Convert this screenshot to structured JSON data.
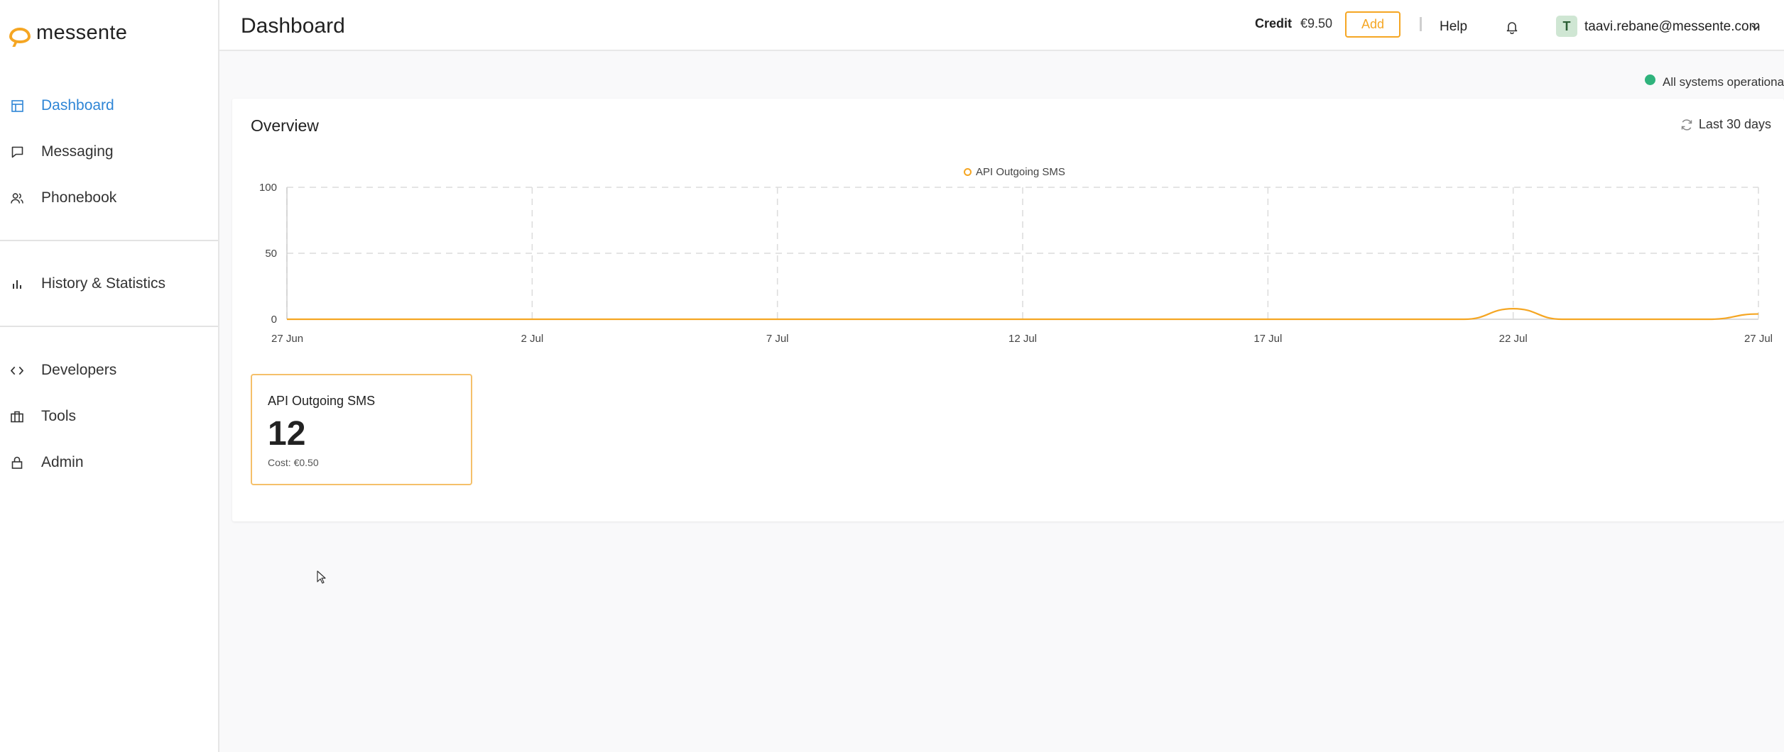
{
  "app": {
    "logo_text": "messente"
  },
  "sidebar": {
    "items": [
      {
        "label": "Dashboard",
        "icon": "dashboard-icon",
        "active": true
      },
      {
        "label": "Messaging",
        "icon": "message-icon"
      },
      {
        "label": "Phonebook",
        "icon": "people-icon"
      },
      {
        "label": "History & Statistics",
        "icon": "bar-chart-icon"
      },
      {
        "label": "Developers",
        "icon": "code-icon"
      },
      {
        "label": "Tools",
        "icon": "briefcase-icon"
      },
      {
        "label": "Admin",
        "icon": "lock-icon"
      }
    ]
  },
  "header": {
    "title": "Dashboard",
    "credit_label": "Credit",
    "credit_value": "€9.50",
    "add_label": "Add",
    "help_label": "Help",
    "avatar_initial": "T",
    "user_email": "taavi.rebane@messente.com"
  },
  "status": {
    "text": "All systems operational",
    "color": "#2fb37c"
  },
  "overview": {
    "title": "Overview",
    "range_label": "Last 30 days"
  },
  "chart_data": {
    "type": "line",
    "series": [
      {
        "name": "API Outgoing SMS",
        "color": "#f5a623",
        "points": [
          {
            "day": 0,
            "value": 0
          },
          {
            "day": 24,
            "value": 0
          },
          {
            "day": 25,
            "value": 8
          },
          {
            "day": 26,
            "value": 0
          },
          {
            "day": 29,
            "value": 0
          },
          {
            "day": 30,
            "value": 4
          }
        ]
      }
    ],
    "x_ticks": [
      "27 Jun",
      "2 Jul",
      "7 Jul",
      "12 Jul",
      "17 Jul",
      "22 Jul",
      "27 Jul"
    ],
    "x_range": [
      0,
      30
    ],
    "y_ticks": [
      0,
      50,
      100
    ],
    "ylim": [
      0,
      100
    ],
    "grid": true,
    "legend": "top-center"
  },
  "stat": {
    "title": "API Outgoing SMS",
    "value": "12",
    "cost": "Cost: €0.50"
  }
}
